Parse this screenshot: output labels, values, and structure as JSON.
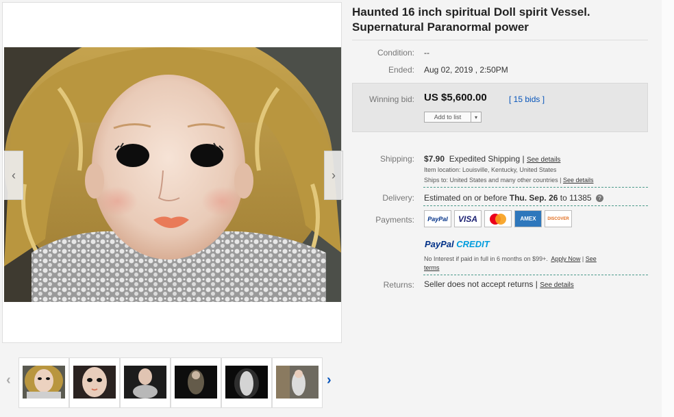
{
  "gallery": {
    "prev_arrow": "‹",
    "next_arrow": "›",
    "strip_prev": "‹",
    "strip_next": "›"
  },
  "listing": {
    "title": "Haunted 16 inch spiritual Doll spirit Vessel. Supernatural Paranormal power",
    "condition_label": "Condition:",
    "condition_value": "--",
    "ended_label": "Ended:",
    "ended_value": "Aug 02, 2019 , 2:50PM"
  },
  "bid": {
    "label": "Winning bid:",
    "price": "US $5,600.00",
    "bids_link": "[ 15 bids ]",
    "add_to_list": "Add to list",
    "add_to_list_caret": "▾"
  },
  "shipping": {
    "label": "Shipping:",
    "cost": "$7.90",
    "method": "Expedited Shipping",
    "separator": "|",
    "see_details": "See details",
    "item_location": "Item location:  Louisville, Kentucky, United States",
    "ships_to": "Ships to:  United States and many other countries",
    "ships_to_sep": "|",
    "ships_to_link": "See details"
  },
  "delivery": {
    "label": "Delivery:",
    "prefix": "Estimated on or before",
    "date": "Thu. Sep. 26",
    "suffix": "to 11385",
    "help": "?"
  },
  "payments": {
    "label": "Payments:",
    "cards": [
      "PayPal",
      "VISA",
      "",
      "AMEX",
      "DISCOVER"
    ],
    "paypal_credit_a": "PayPal",
    "paypal_credit_b": "CREDIT",
    "credit_text": "No Interest if paid in full in 6 months on $99+.",
    "apply_now": "Apply Now",
    "credit_sep": "|",
    "see": "See",
    "terms": "terms"
  },
  "returns": {
    "label": "Returns:",
    "value": "Seller does not accept returns",
    "separator": "|",
    "see_details": "See details"
  },
  "colors": {
    "link_blue": "#0654ba",
    "paypal_dark": "#003087",
    "paypal_light": "#009cde"
  }
}
